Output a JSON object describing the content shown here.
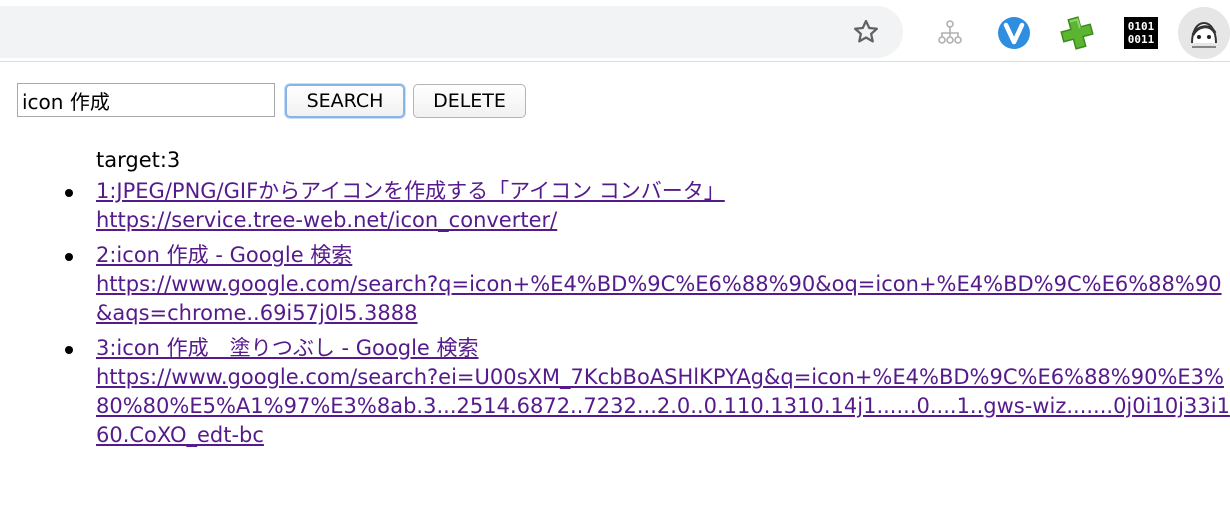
{
  "toolbar": {
    "star_icon": "star-outline-icon",
    "extensions": [
      "sitemap-tree-icon",
      "v-shield-icon",
      "green-plus-icon",
      "binary-icon"
    ],
    "binary_line1": "0101",
    "binary_line2": "0011"
  },
  "form": {
    "search_value": "icon 作成",
    "search_button": "SEARCH",
    "delete_button": "DELETE"
  },
  "results": {
    "target_label": "target:3",
    "items": [
      {
        "title": "1:JPEG/PNG/GIFからアイコンを作成する「アイコン コンバータ」",
        "url": "https://service.tree-web.net/icon_converter/"
      },
      {
        "title": "2:icon 作成 - Google 検索",
        "url": "https://www.google.com/search?q=icon+%E4%BD%9C%E6%88%90&oq=icon+%E4%BD%9C%E6%88%90&aqs=chrome..69i57j0l5.3888"
      },
      {
        "title": "3:icon 作成　塗りつぶし - Google 検索",
        "url": "https://www.google.com/search?ei=U00sXM_7KcbBoASHlKPYAg&q=icon+%E4%BD%9C%E6%88%90%E3%80%80%E5%A1%97%E3%8ab.3...2514.6872..7232...2.0..0.110.1310.14j1......0....1..gws-wiz.......0j0i10j33i160.CoXO_edt-bc"
      }
    ]
  },
  "colors": {
    "link_visited": "#551a8b",
    "omnibox_bg": "#f1f3f4",
    "focus_ring": "#87b5e8"
  }
}
